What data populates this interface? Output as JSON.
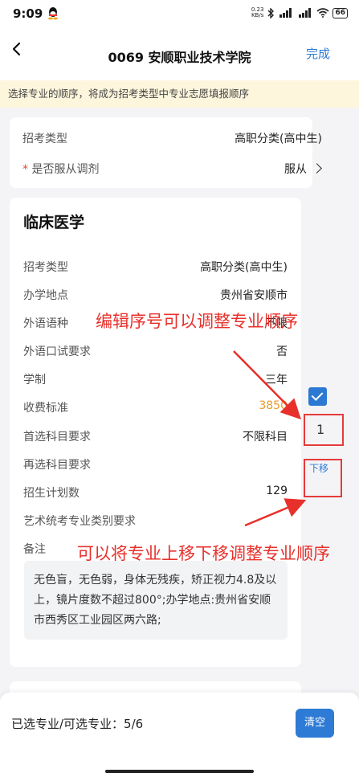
{
  "status_bar": {
    "time": "9:09",
    "net_speed_value": "0.23",
    "net_speed_unit": "KB/s",
    "battery": "66"
  },
  "nav": {
    "title": "0069 安顺职业技术学院",
    "done_label": "完成"
  },
  "notice": "选择专业的顺序，将成为招考类型中专业志愿填报顺序",
  "settings": {
    "exam_type_label": "招考类型",
    "exam_type_value": "高职分类(高中生)",
    "adjust_required_mark": "*",
    "adjust_label": "是否服从调剂",
    "adjust_value": "服从"
  },
  "major_card": {
    "name": "临床医学",
    "fields": [
      {
        "label": "招考类型",
        "value": "高职分类(高中生)"
      },
      {
        "label": "办学地点",
        "value": "贵州省安顺市"
      },
      {
        "label": "外语语种",
        "value": "不限"
      },
      {
        "label": "外语口试要求",
        "value": "否"
      },
      {
        "label": "学制",
        "value": "三年"
      },
      {
        "label": "收费标准",
        "value": "3850"
      },
      {
        "label": "首选科目要求",
        "value": "不限科目"
      },
      {
        "label": "再选科目要求",
        "value": ""
      },
      {
        "label": "招生计划数",
        "value": "129"
      },
      {
        "label": "艺术统考专业类别要求",
        "value": ""
      },
      {
        "label": "备注",
        "value": ""
      }
    ],
    "note_text": "无色盲，无色弱，身体无残疾，矫正视力4.8及以上，镜片度数不超过800°;办学地点:贵州省安顺市西秀区工业园区两六路;",
    "order_number": "1",
    "move_down_label": "下移",
    "selected": true
  },
  "annotations": {
    "edit_order": "编辑序号可以调整专业顺序",
    "move": "可以将专业上移下移调整专业顺序"
  },
  "bottom": {
    "selected_count_text": "已选专业/可选专业：5/6",
    "clear_label": "清空"
  },
  "colors": {
    "accent": "#2e7bd6",
    "annotation": "#e8302b",
    "fee": "#e89a2b",
    "notice_bg": "#fdf5dc"
  }
}
